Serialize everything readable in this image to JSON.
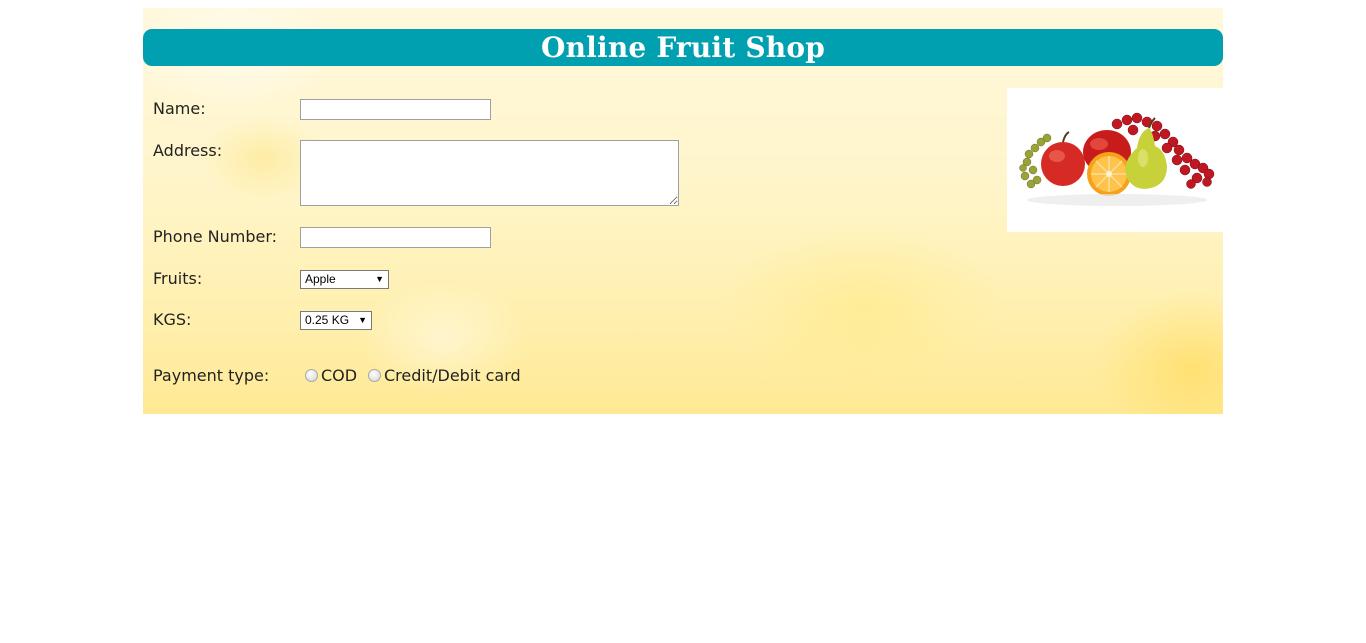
{
  "header": {
    "title": "Online Fruit Shop"
  },
  "form": {
    "name_label": "Name:",
    "name_value": "",
    "address_label": "Address:",
    "address_value": "",
    "phone_label": "Phone Number:",
    "phone_value": "",
    "fruits_label": "Fruits:",
    "fruits_selected": "Apple",
    "kgs_label": "KGS:",
    "kgs_selected": "0.25 KG",
    "payment_label": "Payment type:",
    "payment_options": [
      "COD",
      "Credit/Debit card"
    ]
  },
  "colors": {
    "header_bg": "#00a0b0",
    "header_text": "#ffffff"
  },
  "icons": {
    "dropdown": "dropdown-arrow-icon",
    "image": "fruit-assortment-image"
  }
}
